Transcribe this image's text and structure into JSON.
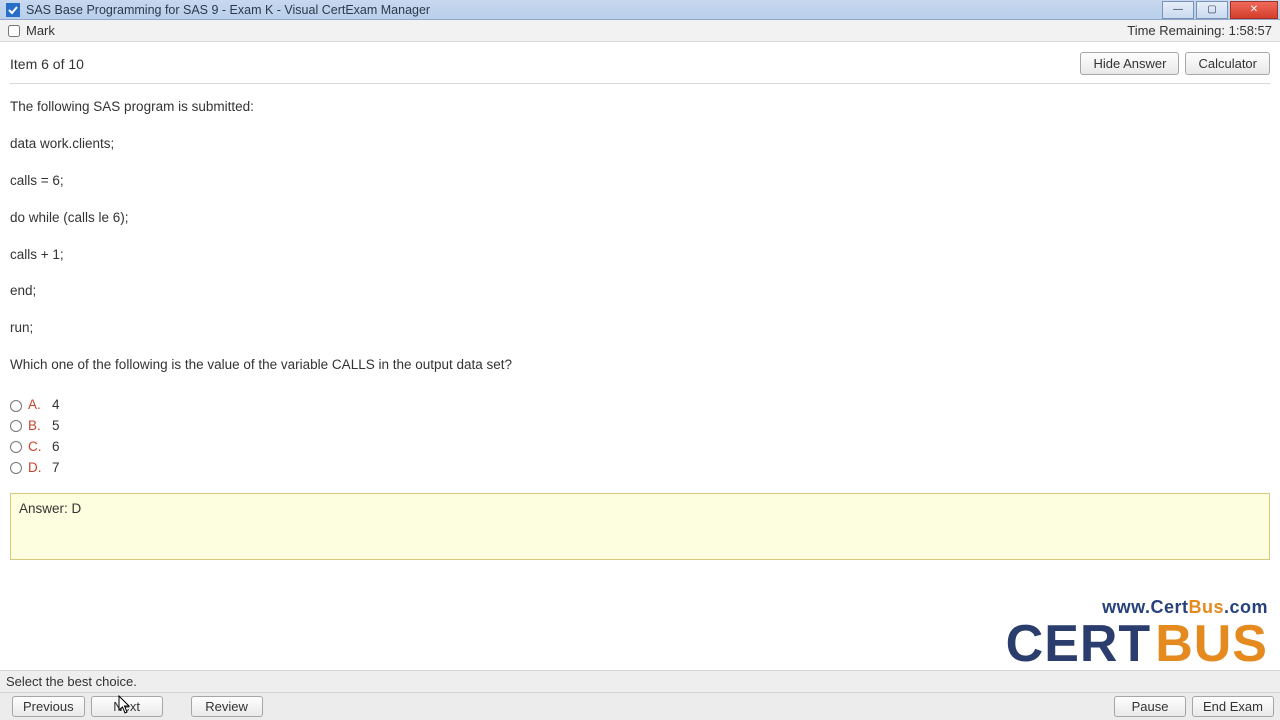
{
  "window": {
    "title": "SAS Base Programming for SAS 9 - Exam K - Visual CertExam Manager"
  },
  "markbar": {
    "mark_label": "Mark",
    "time_label": "Time Remaining: 1:58:57"
  },
  "itemrow": {
    "item_label": "Item 6 of 10",
    "hide_answer": "Hide Answer",
    "calculator": "Calculator"
  },
  "question": {
    "intro": "The following SAS program is submitted:",
    "l1": "data work.clients;",
    "l2": "calls = 6;",
    "l3": "do while (calls le 6);",
    "l4": "calls + 1;",
    "l5": "end;",
    "l6": "run;",
    "prompt": "Which one of the following is the value of the variable CALLS in the output data set?"
  },
  "choices": [
    {
      "letter": "A.",
      "value": "4"
    },
    {
      "letter": "B.",
      "value": "5"
    },
    {
      "letter": "C.",
      "value": "6"
    },
    {
      "letter": "D.",
      "value": "7"
    }
  ],
  "answer": {
    "text": "Answer: D"
  },
  "watermark": {
    "www": "www.",
    "cert": "Cert",
    "bus": "Bus",
    "com": ".com",
    "logo_left": "CERT",
    "logo_right": "BUS"
  },
  "hint": "Select the best choice.",
  "footer": {
    "previous": "Previous",
    "next": "Next",
    "review": "Review",
    "pause": "Pause",
    "end": "End Exam"
  }
}
